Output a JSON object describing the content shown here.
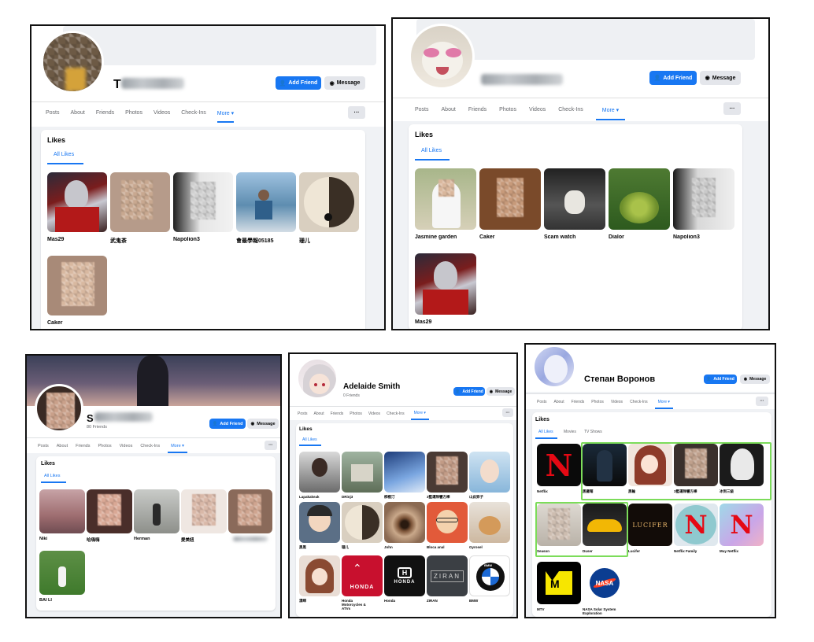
{
  "tabs_label": {
    "posts": "Posts",
    "about": "About",
    "friends": "Friends",
    "photos": "Photos",
    "videos": "Videos",
    "checkins": "Check-Ins",
    "more": "More ▾"
  },
  "common": {
    "add_friend": "Add Friend",
    "message": "Message",
    "likes": "Likes",
    "all_likes": "All Likes",
    "dots": "···"
  },
  "panel1": {
    "name_initial": "T",
    "likes": [
      "Mas29",
      "武鬼茶",
      "Napolion3",
      "會最學報05185",
      "珊儿",
      "Caker"
    ]
  },
  "panel2": {
    "likes": [
      "Jasmine garden",
      "Caker",
      "Scam watch",
      "Dialor",
      "Napolion3",
      "Mas29"
    ]
  },
  "panel3": {
    "name_initial": "S",
    "friends": "80 Friends",
    "likes": [
      "Niki",
      "哈嗨嗨",
      "Herman",
      "愛美妞",
      "BAI LI"
    ]
  },
  "panel4": {
    "name": "Adelaide Smith",
    "friends": "0 Friends",
    "likes": [
      "Lapakakeak",
      "DRinj3",
      "柳橙汀",
      "3籃運隊響方棒",
      "山此猝子",
      "黑黑",
      "珊儿",
      "John",
      "Bloca anal",
      "Gyrosel",
      "漂绵",
      "Honda Motorcycles & ATVs",
      "Honda",
      "ZIRAN",
      "BMW"
    ],
    "logos": {
      "honda": "HONDA",
      "ziran": "ZIRAN",
      "bmw": "BMW"
    }
  },
  "panel5": {
    "name": "Степан Воронов",
    "subtabs": {
      "movies": "Movies",
      "tv": "TV Shows"
    },
    "likes": [
      "Netflix",
      "黑羅莓",
      "黑輪",
      "3籃運隊響方棒",
      "冰到三級",
      "Season",
      "Duser",
      "Lucifer",
      "Netflix Family",
      "Muy Netflix",
      "MTV",
      "NASA Solar System Exploration"
    ],
    "logos": {
      "netflix": "N",
      "lucifer": "LUCIFER",
      "mtv": "M",
      "nasa": "NASA"
    }
  },
  "colors": {
    "brand": "#1877f2",
    "highlight": "#7cdc5a",
    "netflix": "#e50914"
  }
}
